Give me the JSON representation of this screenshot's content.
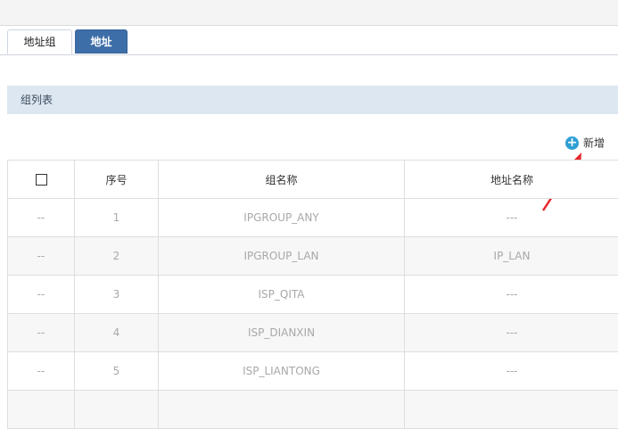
{
  "tabs": [
    {
      "label": "地址组",
      "active": true
    },
    {
      "label": "地址",
      "active": false
    }
  ],
  "section": {
    "title": "组列表"
  },
  "toolbar": {
    "add_label": "新增",
    "add_icon": "plus-circle-icon"
  },
  "table": {
    "columns": [
      "",
      "序号",
      "组名称",
      "地址名称"
    ],
    "rows": [
      {
        "select": "--",
        "index": "1",
        "group": "IPGROUP_ANY",
        "address": "---"
      },
      {
        "select": "--",
        "index": "2",
        "group": "IPGROUP_LAN",
        "address": "IP_LAN"
      },
      {
        "select": "--",
        "index": "3",
        "group": "ISP_QITA",
        "address": "---"
      },
      {
        "select": "--",
        "index": "4",
        "group": "ISP_DIANXIN",
        "address": "---"
      },
      {
        "select": "--",
        "index": "5",
        "group": "ISP_LIANTONG",
        "address": "---"
      },
      {
        "select": "",
        "index": "",
        "group": "",
        "address": ""
      }
    ]
  },
  "colors": {
    "accent": "#3e6ea8",
    "header_bg": "#dde7f1",
    "add_icon": "#2f9fd3",
    "annotation": "#e8262d"
  }
}
